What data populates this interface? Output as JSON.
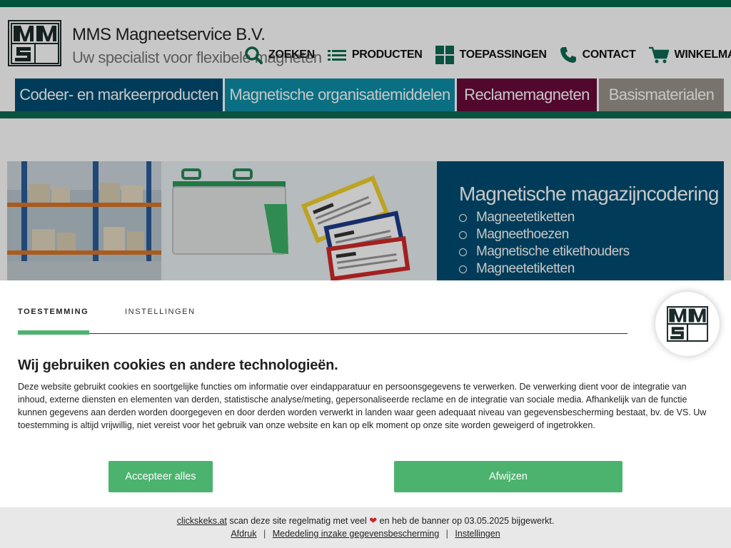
{
  "header": {
    "company_name": "MMS Magneetservice B.V.",
    "tagline": "Uw specialist voor flexibele magneten"
  },
  "topnav": [
    {
      "label": "ZOEKEN",
      "icon": "search-icon"
    },
    {
      "label": "PRODUCTEN",
      "icon": "list-icon"
    },
    {
      "label": "TOEPASSINGEN",
      "icon": "grid-icon"
    },
    {
      "label": "CONTACT",
      "icon": "phone-icon"
    },
    {
      "label": "WINKELMANDJE",
      "icon": "cart-icon"
    }
  ],
  "category_tabs": [
    {
      "label": "Codeer- en markeerproducten",
      "color": "#004d72"
    },
    {
      "label": "Magnetische organisatiemiddelen",
      "color": "#0d8fa8"
    },
    {
      "label": "Reclamemagneten",
      "color": "#6a0a3a"
    },
    {
      "label": "Basismaterialen",
      "color": "#9a948c"
    }
  ],
  "hero": {
    "title": "Magnetische magazijncodering",
    "items": [
      "Magneetetiketten",
      "Magneethoezen",
      "Magnetische etikethouders",
      "Magneetetiketten"
    ]
  },
  "cookie": {
    "tabs": [
      "TOESTEMMING",
      "INSTELLINGEN"
    ],
    "heading": "Wij gebruiken cookies en andere technologieën.",
    "text": "Deze website gebruikt cookies en soortgelijke functies om informatie over eindapparatuur en persoonsgegevens te verwerken. De verwerking dient voor de integratie van inhoud, externe diensten en elementen van derden, statistische analyse/meting, gepersonaliseerde reclame en de integratie van sociale media. Afhankelijk van de functie kunnen gegevens aan derden worden doorgegeven en door derden worden verwerkt in landen waar geen adequaat niveau van gegevensbescherming bestaat, bv. de VS. Uw toestemming is altijd vrijwillig, niet vereist voor het gebruik van onze website en kan op elk moment op onze site worden geweigerd of ingetrokken.",
    "accept_label": "Accepteer alles",
    "reject_label": "Afwijzen",
    "footer": {
      "link_clickskeks": "clickskeks.at",
      "scan_text_1": "scan deze site regelmatig met veel",
      "scan_text_2": "en heb de banner op 03.05.2025 bijgewerkt.",
      "links": [
        "Afdruk",
        "Mededeling inzake gegevensbescherming",
        "Instellingen"
      ]
    }
  },
  "colors": {
    "brand_green": "#0d6b54",
    "button_green": "#4cb36e",
    "hero_panel": "#004d72"
  }
}
